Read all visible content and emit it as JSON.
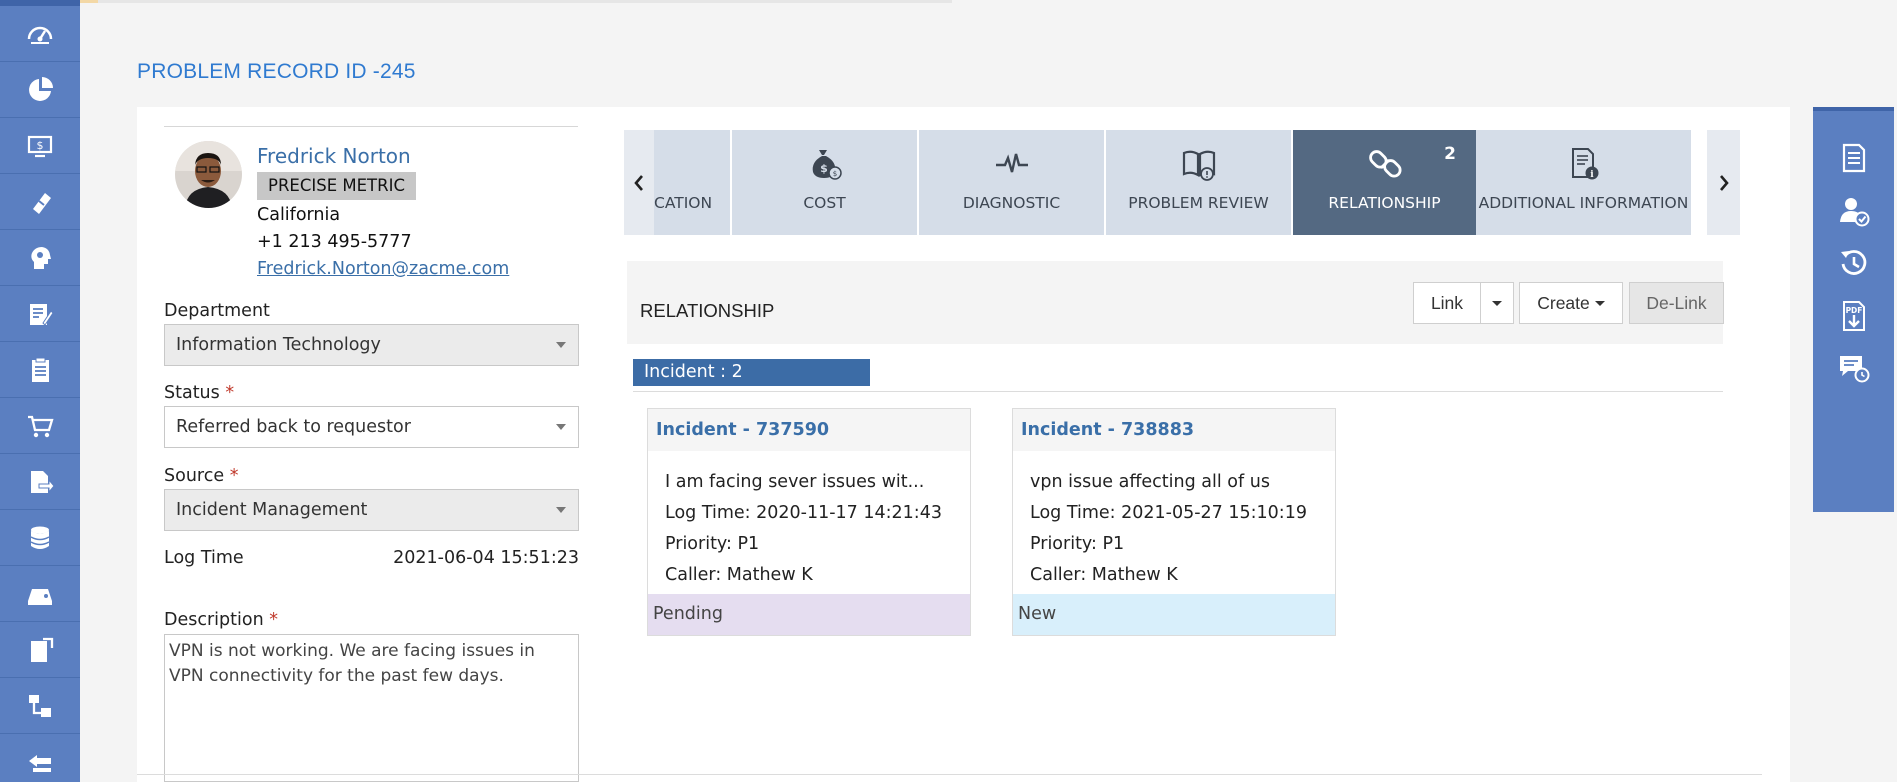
{
  "page": {
    "title": "PROBLEM RECORD ID -245"
  },
  "left_nav": [
    {
      "icon": "dashboard-icon"
    },
    {
      "icon": "pie-chart-icon"
    },
    {
      "icon": "monitor-dollar-icon"
    },
    {
      "icon": "ticket-icon"
    },
    {
      "icon": "head-gear-icon"
    },
    {
      "icon": "edit-document-icon"
    },
    {
      "icon": "clipboard-list-icon"
    },
    {
      "icon": "cart-icon"
    },
    {
      "icon": "file-share-icon"
    },
    {
      "icon": "database-icon"
    },
    {
      "icon": "device-icon"
    },
    {
      "icon": "tablet-note-icon"
    },
    {
      "icon": "flow-icon"
    },
    {
      "icon": "layers-icon"
    }
  ],
  "requester": {
    "name": "Fredrick Norton",
    "company": "PRECISE METRIC",
    "location": "California",
    "phone": "+1 213 495-5777",
    "email": "Fredrick.Norton@zacme.com"
  },
  "form": {
    "department_label": "Department",
    "department_value": "Information Technology",
    "status_label": "Status",
    "status_value": "Referred back to requestor",
    "source_label": "Source",
    "source_value": "Incident Management",
    "required_mark": "*",
    "logtime_label": "Log Time",
    "logtime_value": "2021-06-04 15:51:23",
    "description_label": "Description",
    "description_value": "VPN is not working. We are facing issues in VPN connectivity for the past few days."
  },
  "tabs": {
    "prev": "‹",
    "next": "›",
    "items": [
      {
        "label": "CATION",
        "icon": "notification-icon"
      },
      {
        "label": "COST",
        "icon": "money-bag-icon"
      },
      {
        "label": "DIAGNOSTIC",
        "icon": "pulse-icon"
      },
      {
        "label": "PROBLEM REVIEW",
        "icon": "book-alert-icon"
      },
      {
        "label": "RELATIONSHIP",
        "icon": "link-icon",
        "badge": "2",
        "active": true
      },
      {
        "label": "ADDITIONAL INFORMATION",
        "icon": "document-info-icon"
      }
    ]
  },
  "relationship": {
    "title": "RELATIONSHIP",
    "link_label": "Link",
    "create_label": "Create",
    "delink_label": "De-Link",
    "incident_group": "Incident : 2",
    "cards": [
      {
        "title": "Incident - 737590",
        "summary": "I am facing sever issues wit...",
        "log_time": "Log Time: 2020-11-17 14:21:43",
        "priority": "Priority: P1",
        "caller": "Caller: Mathew K",
        "status": "Pending"
      },
      {
        "title": "Incident - 738883",
        "summary": "vpn issue affecting all of us",
        "log_time": "Log Time: 2021-05-27 15:10:19",
        "priority": "Priority: P1",
        "caller": "Caller: Mathew K",
        "status": "New"
      }
    ]
  },
  "right_actions": [
    {
      "icon": "document-list-icon"
    },
    {
      "icon": "user-approve-icon"
    },
    {
      "icon": "history-icon"
    },
    {
      "icon": "pdf-download-icon"
    },
    {
      "icon": "chat-clock-icon"
    }
  ],
  "colors": {
    "nav_blue": "#5b7fc1",
    "title_blue": "#2f7ad0",
    "active_tab": "#546982",
    "incident_bar": "#3c6ca6",
    "pending": "#e5ddf0",
    "new": "#d8effb"
  }
}
